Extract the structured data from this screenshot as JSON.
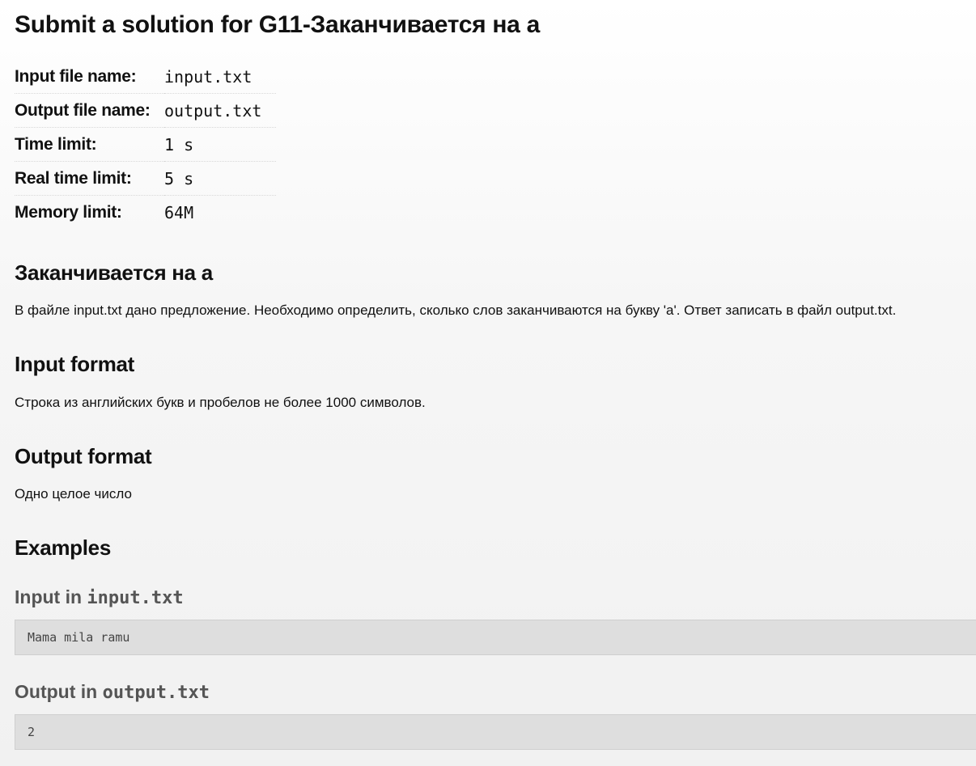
{
  "header": {
    "title": "Submit a solution for G11-Заканчивается на а"
  },
  "limits": [
    {
      "label": "Input file name:",
      "value": "input.txt"
    },
    {
      "label": "Output file name:",
      "value": "output.txt"
    },
    {
      "label": "Time limit:",
      "value": "1 s"
    },
    {
      "label": "Real time limit:",
      "value": "5 s"
    },
    {
      "label": "Memory limit:",
      "value": "64M"
    }
  ],
  "statement": {
    "heading": "Заканчивается на а",
    "text": "В файле input.txt дано предложение. Необходимо определить, сколько слов заканчиваются на букву 'а'. Ответ записать в файл output.txt."
  },
  "input_format": {
    "heading": "Input format",
    "text": "Строка из английских букв и пробелов не более 1000 символов."
  },
  "output_format": {
    "heading": "Output format",
    "text": "Одно целое число"
  },
  "examples": {
    "heading": "Examples",
    "input_label": "Input in",
    "input_file": "input.txt",
    "input_content": "Mama mila ramu",
    "output_label": "Output in",
    "output_file": "output.txt",
    "output_content": "2"
  }
}
